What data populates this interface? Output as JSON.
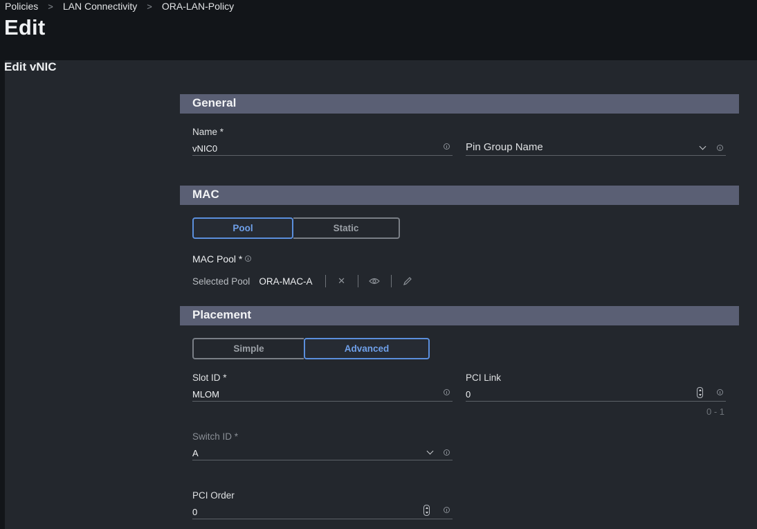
{
  "breadcrumb": [
    "Policies",
    "LAN Connectivity",
    "ORA-LAN-Policy"
  ],
  "page_title": "Edit",
  "subtitle": "Edit vNIC",
  "general": {
    "heading": "General",
    "name_label": "Name *",
    "name_value": "vNIC0",
    "pin_group_placeholder": "Pin Group Name"
  },
  "mac": {
    "heading": "MAC",
    "mode_options": [
      "Pool",
      "Static"
    ],
    "selected_mode": "Pool",
    "pool_label": "MAC Pool *",
    "selected_pool_label": "Selected Pool",
    "selected_pool_value": "ORA-MAC-A"
  },
  "placement": {
    "heading": "Placement",
    "mode_options": [
      "Simple",
      "Advanced"
    ],
    "selected_mode": "Advanced",
    "slot_id_label": "Slot ID *",
    "slot_id_value": "MLOM",
    "pci_link_label": "PCI Link",
    "pci_link_value": "0",
    "pci_link_range": "0 - 1",
    "switch_id_label": "Switch ID *",
    "switch_id_value": "A",
    "pci_order_label": "PCI Order",
    "pci_order_value": "0"
  },
  "icons": [
    "chevron-right-icon",
    "info-icon",
    "chevron-down-icon",
    "close-icon",
    "eye-icon",
    "pencil-icon",
    "stepper-icon"
  ],
  "colors": {
    "accent": "#5b8fdd",
    "section_bar": "#5a5f74",
    "panel": "#23272d",
    "header": "#121519"
  }
}
